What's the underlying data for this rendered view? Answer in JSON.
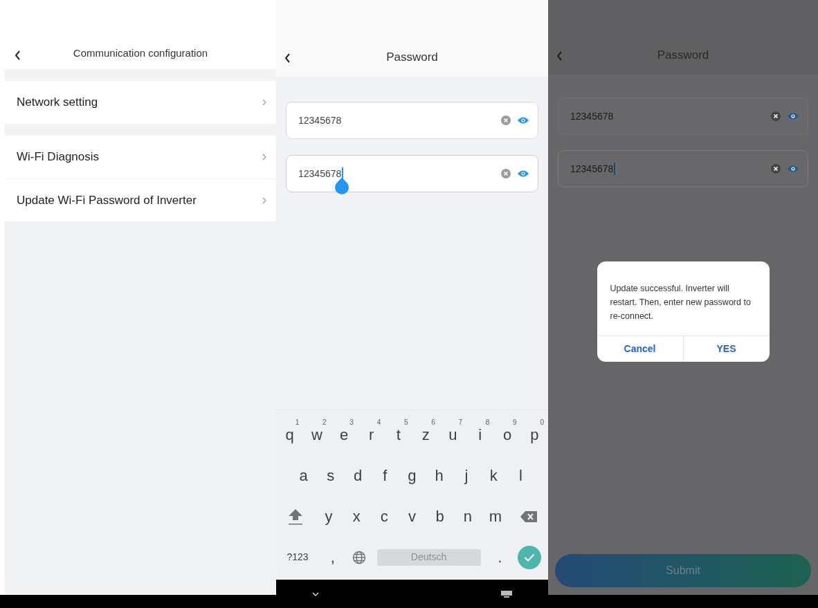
{
  "left_screen": {
    "title": "Communication configuration",
    "sections": [
      {
        "items": [
          {
            "label": "Network setting"
          }
        ]
      },
      {
        "items": [
          {
            "label": "Wi-Fi Diagnosis"
          },
          {
            "label": "Update Wi-Fi Password of Inverter"
          }
        ]
      }
    ]
  },
  "middle_screen": {
    "title": "Password",
    "fields": [
      {
        "value": "12345678",
        "focused": false
      },
      {
        "value": "12345678",
        "focused": true
      }
    ],
    "keyboard": {
      "rows": [
        {
          "keys": [
            {
              "kind": "letter",
              "label": "q",
              "hint": "1"
            },
            {
              "kind": "letter",
              "label": "w",
              "hint": "2"
            },
            {
              "kind": "letter",
              "label": "e",
              "hint": "3"
            },
            {
              "kind": "letter",
              "label": "r",
              "hint": "4"
            },
            {
              "kind": "letter",
              "label": "t",
              "hint": "5"
            },
            {
              "kind": "letter",
              "label": "z",
              "hint": "6"
            },
            {
              "kind": "letter",
              "label": "u",
              "hint": "7"
            },
            {
              "kind": "letter",
              "label": "i",
              "hint": "8"
            },
            {
              "kind": "letter",
              "label": "o",
              "hint": "9"
            },
            {
              "kind": "letter",
              "label": "p",
              "hint": "0"
            }
          ]
        },
        {
          "keys": [
            {
              "kind": "letter",
              "label": "a"
            },
            {
              "kind": "letter",
              "label": "s"
            },
            {
              "kind": "letter",
              "label": "d"
            },
            {
              "kind": "letter",
              "label": "f"
            },
            {
              "kind": "letter",
              "label": "g"
            },
            {
              "kind": "letter",
              "label": "h"
            },
            {
              "kind": "letter",
              "label": "j"
            },
            {
              "kind": "letter",
              "label": "k"
            },
            {
              "kind": "letter",
              "label": "l"
            }
          ]
        },
        {
          "keys": [
            {
              "kind": "shift"
            },
            {
              "kind": "letter",
              "label": "y"
            },
            {
              "kind": "letter",
              "label": "x"
            },
            {
              "kind": "letter",
              "label": "c"
            },
            {
              "kind": "letter",
              "label": "v"
            },
            {
              "kind": "letter",
              "label": "b"
            },
            {
              "kind": "letter",
              "label": "n"
            },
            {
              "kind": "letter",
              "label": "m"
            },
            {
              "kind": "backspace"
            }
          ]
        },
        {
          "keys": [
            {
              "kind": "symbols",
              "label": "?123"
            },
            {
              "kind": "letter",
              "label": ","
            },
            {
              "kind": "globe"
            },
            {
              "kind": "space",
              "label": "Deutsch"
            },
            {
              "kind": "letter",
              "label": "."
            },
            {
              "kind": "enter"
            }
          ]
        }
      ]
    }
  },
  "right_screen": {
    "title": "Password",
    "fields": [
      {
        "value": "12345678",
        "focused": false
      },
      {
        "value": "12345678",
        "focused": true
      }
    ],
    "dialog": {
      "message": "Update successful. Inverter will restart. Then, enter new password to re-connect.",
      "buttons": [
        "Cancel",
        "YES"
      ]
    },
    "submit_button": "Submit"
  }
}
